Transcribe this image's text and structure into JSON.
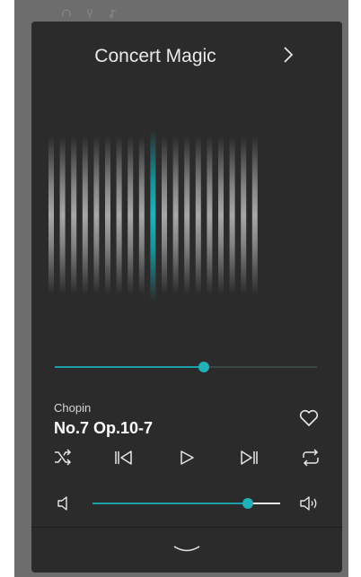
{
  "app": {
    "title": "Concert Magic"
  },
  "playback": {
    "progress": 0.57
  },
  "track": {
    "composer": "Chopin",
    "title": "No.7 Op.10-7"
  },
  "volume": {
    "level": 0.83
  },
  "colors": {
    "accent": "#1aa0a8",
    "panel": "#2b2b2b",
    "backdrop": "#6d6d6d"
  },
  "icons": {
    "header": "chevron-right-icon",
    "favorite": "heart-icon",
    "controls": [
      "shuffle-icon",
      "previous-track-icon",
      "play-icon",
      "next-track-icon",
      "repeat-icon"
    ],
    "volume": [
      "volume-low-icon",
      "volume-high-icon"
    ],
    "footer": "chevron-down-icon"
  }
}
